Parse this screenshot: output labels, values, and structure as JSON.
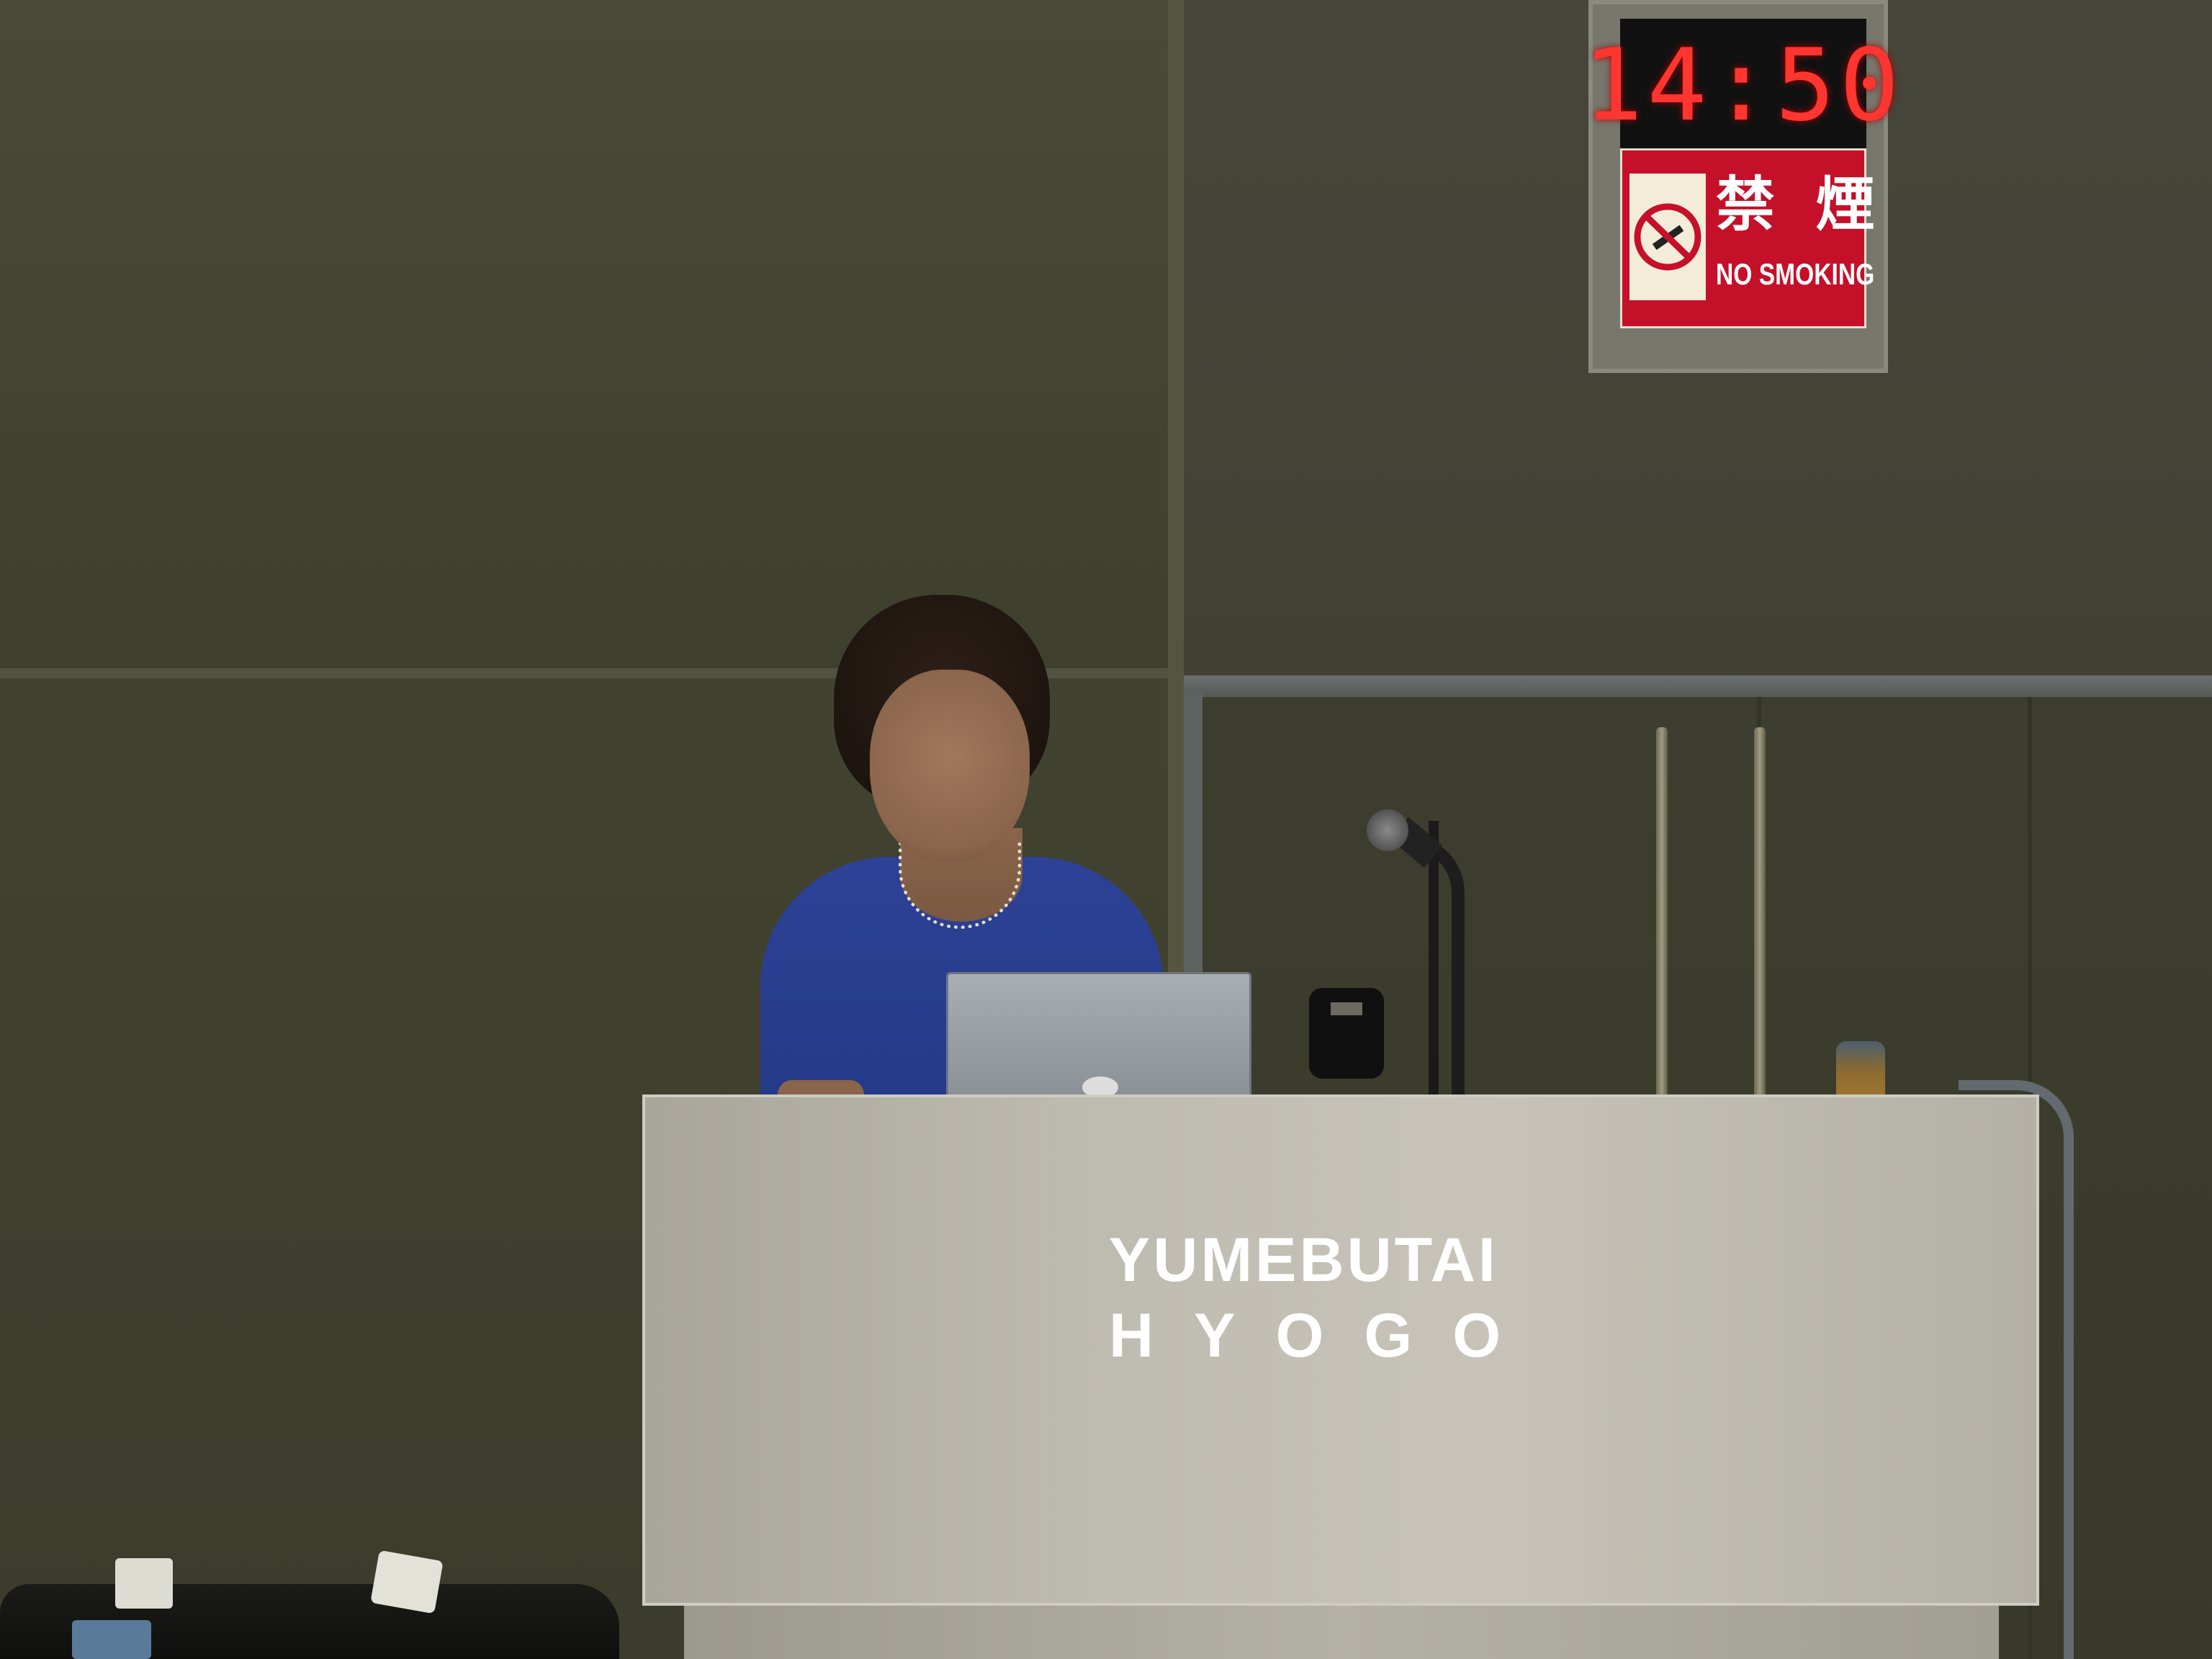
{
  "clock": {
    "time": "14:50"
  },
  "sign": {
    "kanji": "禁 煙",
    "english": "NO SMOKING",
    "icon": "no-smoking-icon"
  },
  "podium": {
    "line1": "YUMEBUTAI",
    "line2": "HYOGO"
  },
  "colors": {
    "clock_digits": "#ff3530",
    "sign_background": "#c5102a",
    "speaker_shirt": "#2d4296",
    "podium": "#c2beb3",
    "wall": "#434330"
  }
}
